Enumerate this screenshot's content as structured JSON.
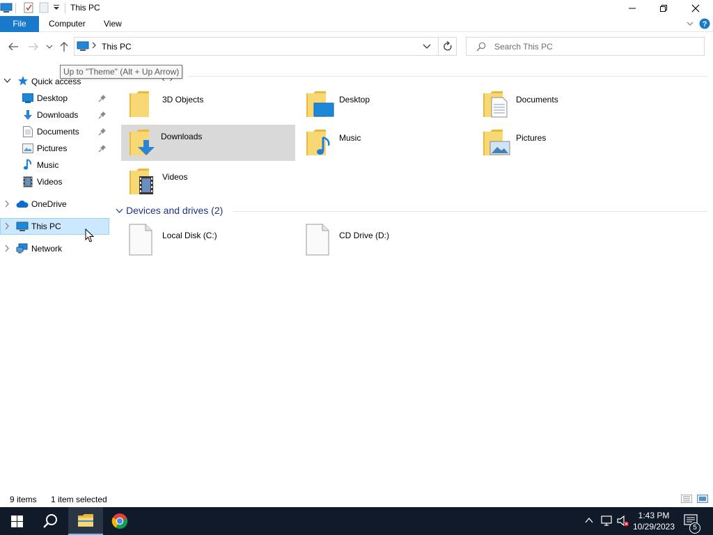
{
  "window": {
    "title": "This PC"
  },
  "ribbon": {
    "tabs": [
      "File",
      "Computer",
      "View"
    ]
  },
  "address": {
    "path": "This PC",
    "search_placeholder": "Search This PC",
    "tooltip": "Up to \"Theme\" (Alt + Up Arrow)"
  },
  "nav": {
    "quick_access": "Quick access",
    "quick_items": [
      "Desktop",
      "Downloads",
      "Documents",
      "Pictures",
      "Music",
      "Videos"
    ],
    "onedrive": "OneDrive",
    "this_pc": "This PC",
    "network": "Network"
  },
  "content": {
    "folders_header": "Folders (7)",
    "folders": [
      "3D Objects",
      "Desktop",
      "Documents",
      "Downloads",
      "Music",
      "Pictures",
      "Videos"
    ],
    "selected_folder": "Downloads",
    "drives_header": "Devices and drives (2)",
    "drives": [
      "Local Disk (C:)",
      "CD Drive (D:)"
    ]
  },
  "status": {
    "items": "9 items",
    "selected": "1 item selected"
  },
  "taskbar": {
    "time": "1:43 PM",
    "date": "10/29/2023",
    "notification_count": "5"
  },
  "colors": {
    "accent": "#1979ca",
    "selection": "#cce8ff",
    "folder": "#f8d775",
    "taskbar": "#101a29",
    "group_header": "#1e3287"
  }
}
